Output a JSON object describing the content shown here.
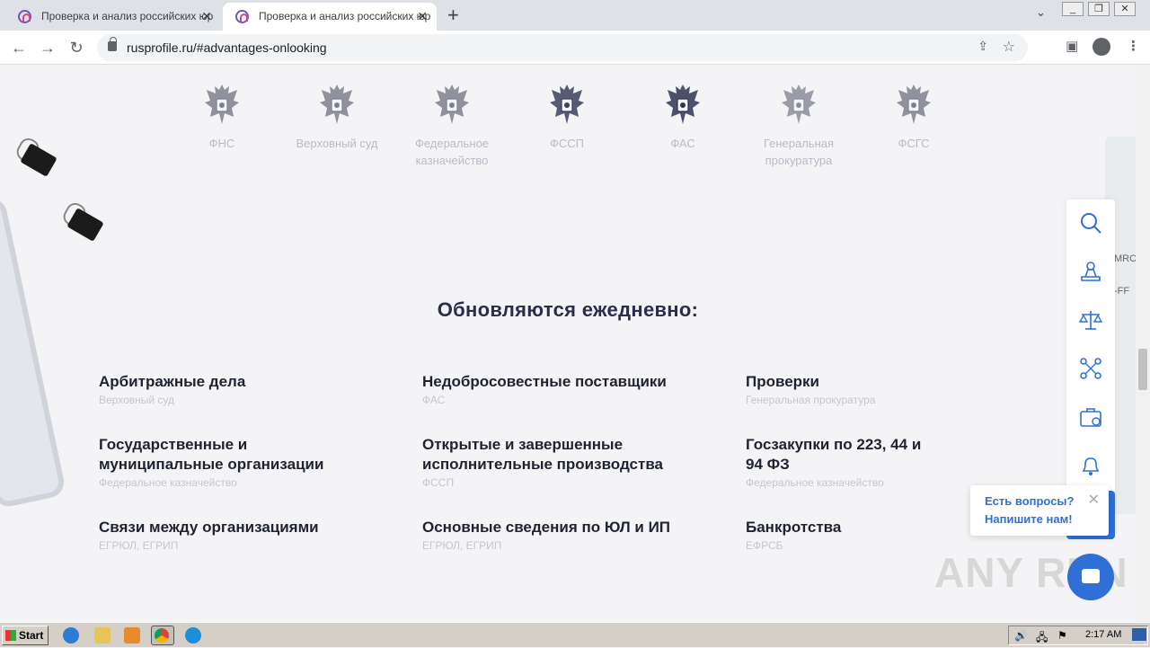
{
  "browser": {
    "tabs": [
      {
        "title": "Проверка и анализ российских юр"
      },
      {
        "title": "Проверка и анализ российских юр"
      }
    ],
    "url": "rusprofile.ru/#advantages-onlooking",
    "new_tab": "+",
    "tab_close": "✕"
  },
  "orgs": [
    {
      "name": "ФНС"
    },
    {
      "name": "Верховный суд"
    },
    {
      "name": "Федеральное казначейство"
    },
    {
      "name": "ФССП"
    },
    {
      "name": "ФАС"
    },
    {
      "name": "Генеральная прокуратура"
    },
    {
      "name": "ФСГС"
    }
  ],
  "heading": "Обновляются ежедневно:",
  "items": [
    {
      "title": "Арбитражные дела",
      "source": "Верховный суд"
    },
    {
      "title": "Недобросовестные поставщики",
      "source": "ФАС"
    },
    {
      "title": "Проверки",
      "source": "Генеральная прокуратура"
    },
    {
      "title": "Государственные и муниципальные организации",
      "source": "Федеральное казначейство"
    },
    {
      "title": "Открытые и завершенные исполнительные производства",
      "source": "ФССП"
    },
    {
      "title": "Госзакупки по 223, 44 и 94 ФЗ",
      "source": "Федеральное казначейство"
    },
    {
      "title": "Связи между организациями",
      "source": "ЕГРЮЛ, ЕГРИП"
    },
    {
      "title": "Основные сведения по ЮЛ и ИП",
      "source": "ЕГРЮЛ, ЕГРИП"
    },
    {
      "title": "Банкротства",
      "source": "ЕФРСБ"
    }
  ],
  "chat": {
    "line1": "Есть вопросы?",
    "line2": "Напишите нам!"
  },
  "watermark": "ANY RUN",
  "taskbar": {
    "start": "Start",
    "clock": "2:17 AM"
  },
  "colors": {
    "accent": "#2f6fd6",
    "heading": "#2a2e4a",
    "muted": "#c3c7cf"
  }
}
